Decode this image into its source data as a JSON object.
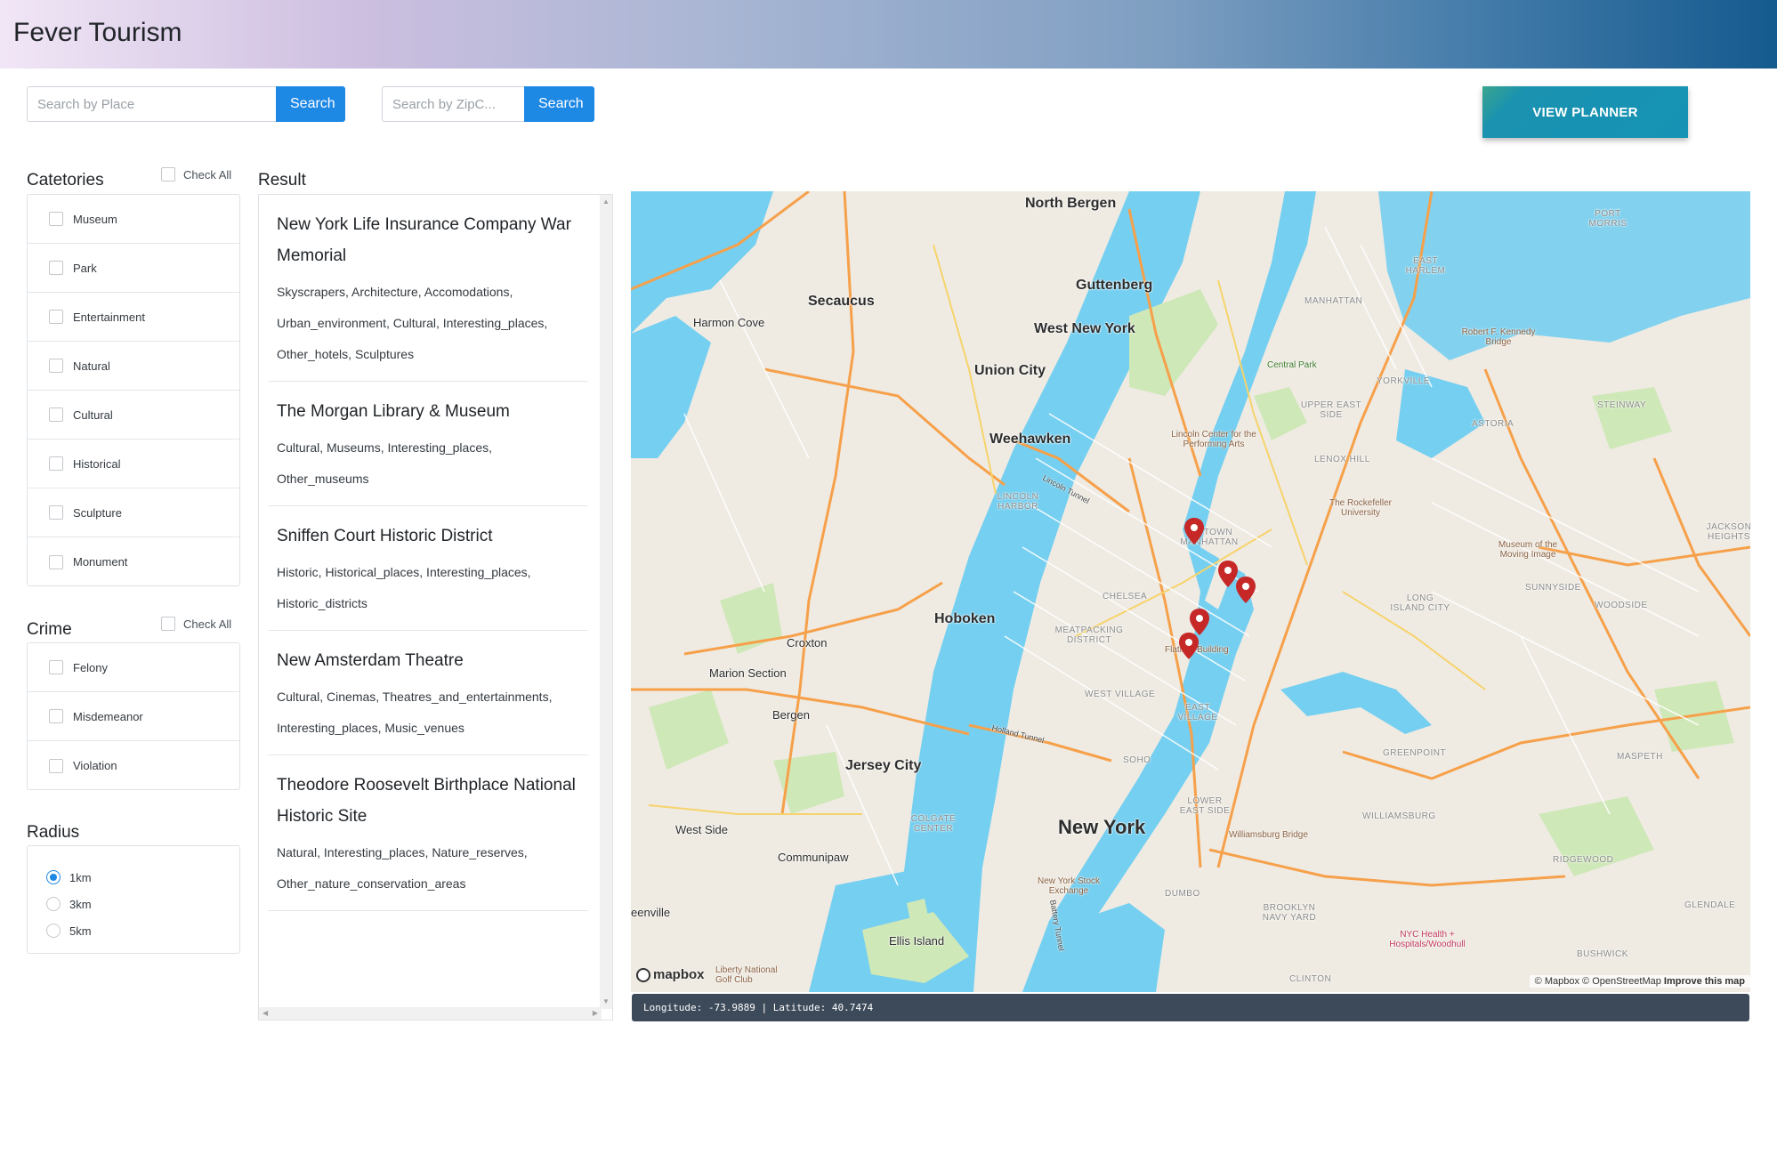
{
  "app": {
    "title": "Fever Tourism"
  },
  "search_place": {
    "placeholder": "Search by Place",
    "button": "Search"
  },
  "search_zip": {
    "placeholder": "Search by ZipC...",
    "button": "Search"
  },
  "planner_button": "VIEW PLANNER",
  "categories": {
    "title": "Catetories",
    "check_all": "Check All",
    "items": [
      "Museum",
      "Park",
      "Entertainment",
      "Natural",
      "Cultural",
      "Historical",
      "Sculpture",
      "Monument"
    ]
  },
  "crime": {
    "title": "Crime",
    "check_all": "Check All",
    "items": [
      "Felony",
      "Misdemeanor",
      "Violation"
    ]
  },
  "radius": {
    "title": "Radius",
    "options": [
      "1km",
      "3km",
      "5km"
    ],
    "selected": "1km"
  },
  "result": {
    "title": "Result",
    "items": [
      {
        "name": "New York Life Insurance Company War Memorial",
        "tags": "Skyscrapers, Architecture, Accomodations, Urban_environment, Cultural, Interesting_places, Other_hotels, Sculptures"
      },
      {
        "name": "The Morgan Library & Museum",
        "tags": "Cultural, Museums, Interesting_places, Other_museums"
      },
      {
        "name": "Sniffen Court Historic District",
        "tags": "Historic, Historical_places, Interesting_places, Historic_districts"
      },
      {
        "name": "New Amsterdam Theatre",
        "tags": "Cultural, Cinemas, Theatres_and_entertainments, Interesting_places, Music_venues"
      },
      {
        "name": "Theodore Roosevelt Birthplace National Historic Site",
        "tags": "Natural, Interesting_places, Nature_reserves, Other_nature_conservation_areas"
      }
    ]
  },
  "map": {
    "labels": {
      "north_bergen": "North Bergen",
      "guttenberg": "Guttenberg",
      "secaucus": "Secaucus",
      "harmon_cove": "Harmon Cove",
      "west_new_york": "West New York",
      "union_city": "Union City",
      "weehawken": "Weehawken",
      "hoboken": "Hoboken",
      "croxton": "Croxton",
      "marion_section": "Marion Section",
      "bergen": "Bergen",
      "jersey_city": "Jersey City",
      "west_side": "West Side",
      "communipaw": "Communipaw",
      "new_york": "New York",
      "ellis_island": "Ellis Island",
      "liberty_golf": "Liberty National Golf Club",
      "eenville": "eenville",
      "central_park": "Central Park",
      "manhattan": "MANHATTAN",
      "east_harlem": "EAST HARLEM",
      "upper_east_side": "UPPER EAST SIDE",
      "yorkville": "YORKVILLE",
      "lenox_hill": "LENOX HILL",
      "lincoln_center": "Lincoln Center for the Performing Arts",
      "midtown": "MIDTOWN MANHATTAN",
      "chelsea": "CHELSEA",
      "meatpacking": "MEATPACKING DISTRICT",
      "flatiron": "Flatiron Building",
      "east_village": "EAST VILLAGE",
      "soho": "SOHO",
      "lower_east_side": "LOWER EAST SIDE",
      "nyse": "New York Stock Exchange",
      "dumbo": "DUMBO",
      "brooklyn_navy_yard": "BROOKLYN NAVY YARD",
      "williamsburg": "WILLIAMSBURG",
      "williamsburg_bridge": "Williamsburg Bridge",
      "greenpoint": "GREENPOINT",
      "long_island_city": "LONG ISLAND CITY",
      "sunnyside": "SUNNYSIDE",
      "woodside": "WOODSIDE",
      "maspeth": "MASPETH",
      "ridgewood": "RIDGEWOOD",
      "glendale": "GLENDALE",
      "bushwick": "BUSHWICK",
      "astoria": "ASTORIA",
      "steinway": "STEINWAY",
      "jackson_heights": "JACKSON HEIGHTS",
      "port_morris": "PORT MORRIS",
      "rfk_bridge": "Robert F. Kennedy Bridge",
      "rockefeller_univ": "The Rockefeller University",
      "moving_image": "Museum of the Moving Image",
      "nyc_health": "NYC Health + Hospitals/Woodhull",
      "clinton": "CLINTON",
      "lincoln_harbor": "LINCOLN HARBOR",
      "colgate_center": "COLGATE CENTER",
      "holland_tunnel": "Holland Tunnel",
      "lincoln_tunnel": "Lincoln Tunnel",
      "battery_tunnel": "Battery Tunnel",
      "west_village": "WEST VILLAGE"
    },
    "attribution": {
      "mapbox": "© Mapbox",
      "osm": "© OpenStreetMap",
      "improve": "Improve this map"
    },
    "logo": "mapbox",
    "coords": "Longitude: -73.9889 | Latitude: 40.7474",
    "marker_color": "#c62828",
    "water_color": "#75cff0",
    "park_color": "#cfe8b8"
  }
}
